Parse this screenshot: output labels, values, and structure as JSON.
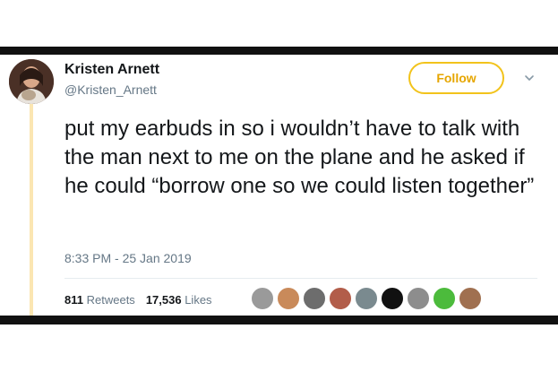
{
  "tweet": {
    "author_name": "Kristen Arnett",
    "author_handle": "@Kristen_Arnett",
    "follow_label": "Follow",
    "text": "put my earbuds in so i wouldn’t have to talk with the man next to me on the plane and he asked if he could “borrow one so we could listen together”",
    "timestamp": "8:33 PM - 25 Jan 2019",
    "retweets_count": "811",
    "retweets_label": "Retweets",
    "likes_count": "17,536",
    "likes_label": "Likes"
  },
  "icons": {
    "menu": "chevron-down-icon"
  },
  "colors": {
    "follow_accent": "#e6a600",
    "follow_border": "#f2c31b",
    "thread_line": "#fbe6b2",
    "secondary_text": "#657786"
  },
  "liker_avatar_colors": [
    "#9a9a9a",
    "#c98a5a",
    "#6d6d6d",
    "#b25d4a",
    "#7a8a8f",
    "#111111",
    "#8d8d8d",
    "#4cbb3c",
    "#a07050"
  ]
}
